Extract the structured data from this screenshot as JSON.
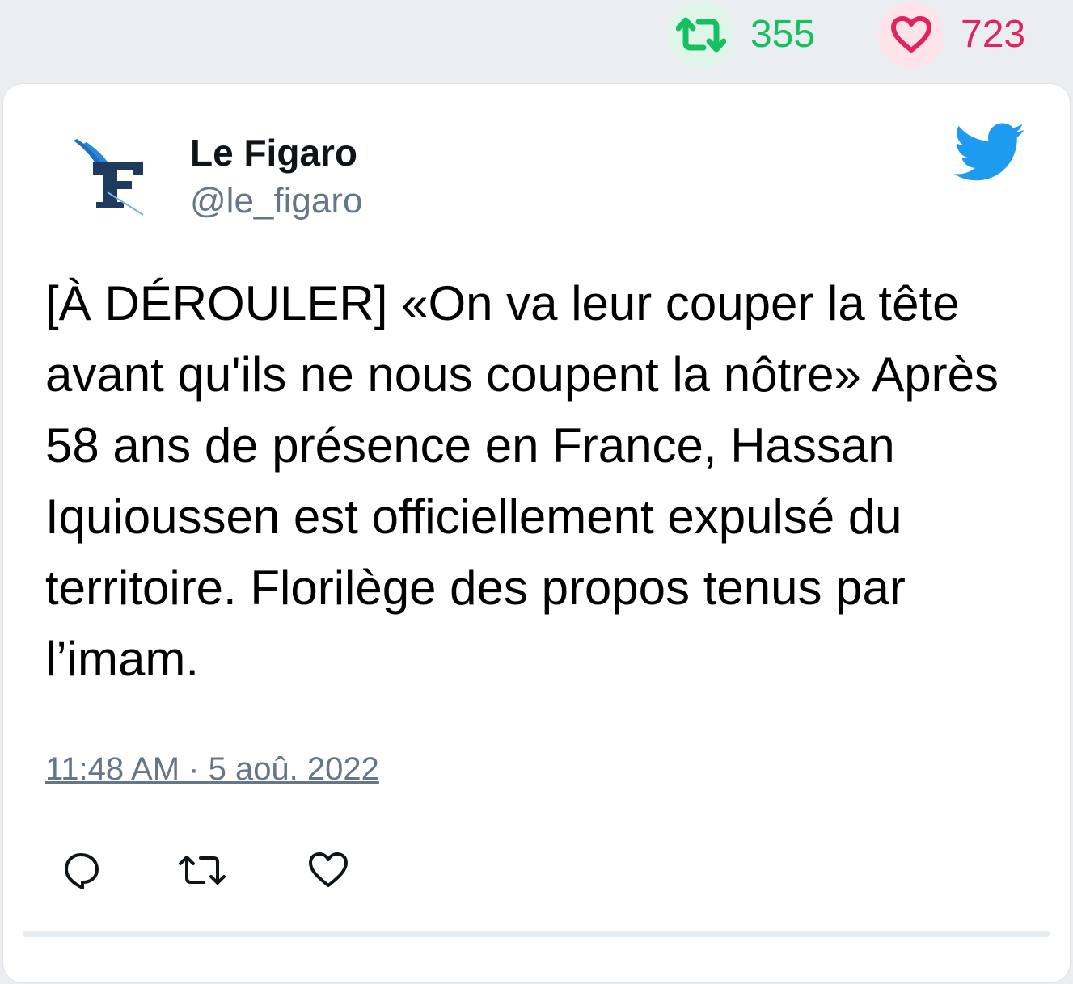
{
  "stats": {
    "retweet_count": "355",
    "like_count": "723"
  },
  "tweet": {
    "display_name": "Le Figaro",
    "handle": "@le_figaro",
    "text": "[À DÉROULER] «On va leur couper la tête avant qu'ils ne nous coupent la nôtre» Après 58 ans de présence en France, Hassan Iquioussen est officiellement expulsé du territoire. Florilège des propos tenus par l’imam.",
    "timestamp": "11:48 AM · 5 aoû. 2022"
  },
  "icons": {
    "stat_retweet": "retweet-icon",
    "stat_like": "heart-icon",
    "brand": "twitter-bird-icon",
    "avatar": "le-figaro-logo",
    "actions": [
      "reply-icon",
      "retweet-icon",
      "heart-icon"
    ]
  },
  "colors": {
    "retweet": "#17bf63",
    "like": "#e0245e",
    "twitter_blue": "#1d9bf0",
    "muted": "#657786",
    "background": "#ebeef0"
  }
}
